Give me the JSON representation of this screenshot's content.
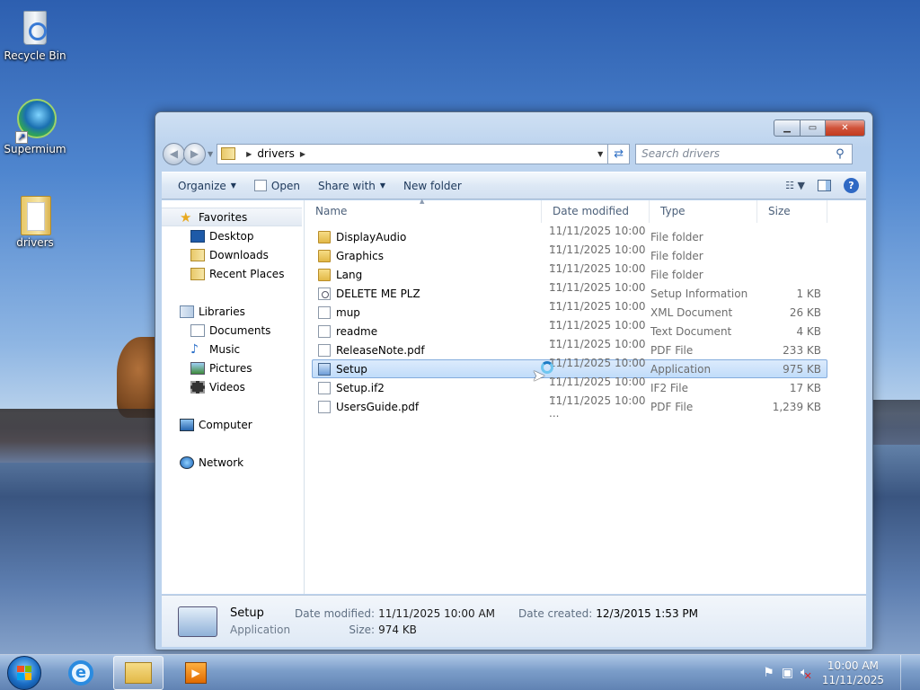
{
  "desktop": {
    "icons": [
      {
        "label": "Recycle Bin"
      },
      {
        "label": "Supermium"
      },
      {
        "label": "drivers"
      }
    ]
  },
  "window": {
    "address": {
      "folder": "drivers"
    },
    "search": {
      "placeholder": "Search drivers"
    },
    "toolbar": {
      "organize": "Organize",
      "open": "Open",
      "share_with": "Share with",
      "new_folder": "New folder"
    },
    "nav": {
      "favorites": "Favorites",
      "desktop": "Desktop",
      "downloads": "Downloads",
      "recent": "Recent Places",
      "libraries": "Libraries",
      "documents": "Documents",
      "music": "Music",
      "pictures": "Pictures",
      "videos": "Videos",
      "computer": "Computer",
      "network": "Network"
    },
    "columns": {
      "name": "Name",
      "date": "Date modified",
      "type": "Type",
      "size": "Size"
    },
    "files": [
      {
        "name": "DisplayAudio",
        "date": "11/11/2025 10:00 ...",
        "type": "File folder",
        "size": "",
        "icon": "folder"
      },
      {
        "name": "Graphics",
        "date": "11/11/2025 10:00 ...",
        "type": "File folder",
        "size": "",
        "icon": "folder"
      },
      {
        "name": "Lang",
        "date": "11/11/2025 10:00 ...",
        "type": "File folder",
        "size": "",
        "icon": "folder"
      },
      {
        "name": "DELETE ME PLZ",
        "date": "11/11/2025 10:00 ...",
        "type": "Setup Information",
        "size": "1 KB",
        "icon": "setup-info"
      },
      {
        "name": "mup",
        "date": "11/11/2025 10:00 ...",
        "type": "XML Document",
        "size": "26 KB",
        "icon": "file"
      },
      {
        "name": "readme",
        "date": "11/11/2025 10:00 ...",
        "type": "Text Document",
        "size": "4 KB",
        "icon": "file"
      },
      {
        "name": "ReleaseNote.pdf",
        "date": "11/11/2025 10:00 ...",
        "type": "PDF File",
        "size": "233 KB",
        "icon": "file"
      },
      {
        "name": "Setup",
        "date": "11/11/2025 10:00 ...",
        "type": "Application",
        "size": "975 KB",
        "icon": "application",
        "selected": true
      },
      {
        "name": "Setup.if2",
        "date": "11/11/2025 10:00 ...",
        "type": "IF2 File",
        "size": "17 KB",
        "icon": "file"
      },
      {
        "name": "UsersGuide.pdf",
        "date": "11/11/2025 10:00 ...",
        "type": "PDF File",
        "size": "1,239 KB",
        "icon": "file"
      }
    ],
    "details": {
      "name": "Setup",
      "type": "Application",
      "modified_label": "Date modified:",
      "modified": "11/11/2025 10:00 AM",
      "size_label": "Size:",
      "size": "974 KB",
      "created_label": "Date created:",
      "created": "12/3/2015 1:53 PM"
    }
  },
  "taskbar": {
    "time": "10:00 AM",
    "date": "11/11/2025"
  }
}
